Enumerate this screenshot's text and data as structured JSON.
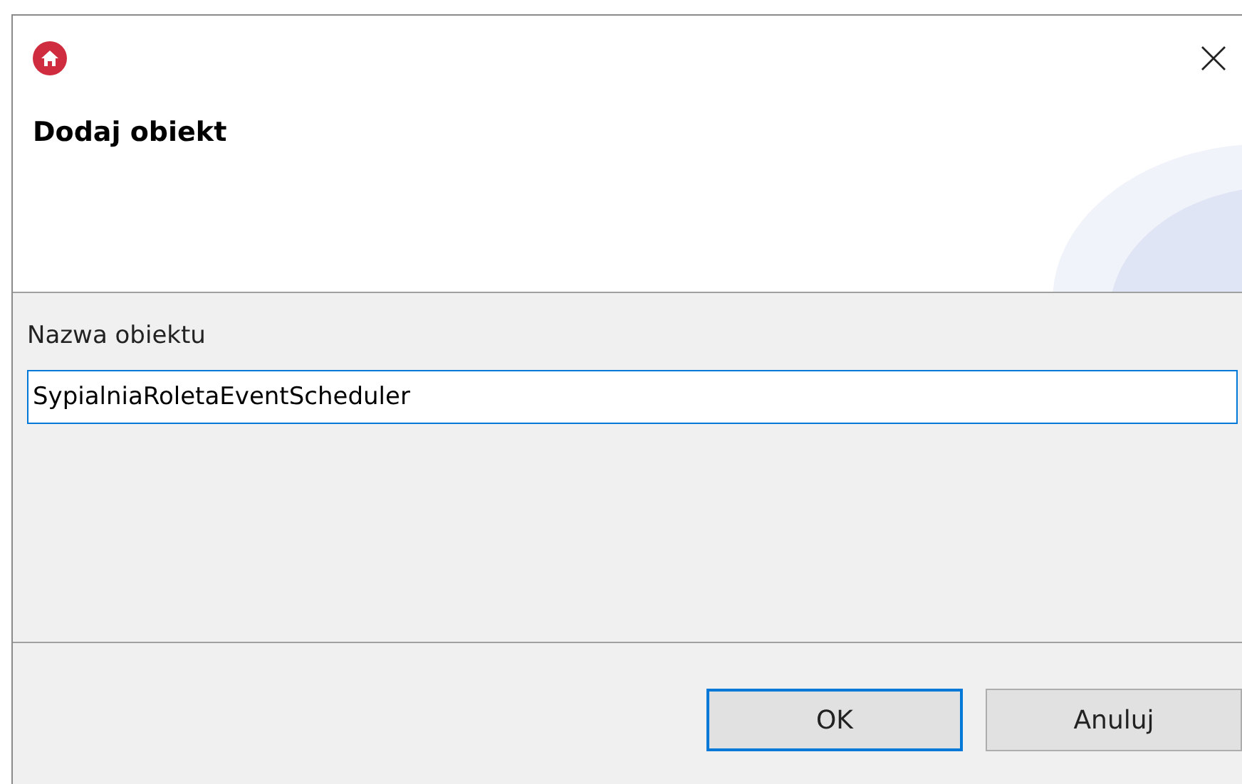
{
  "window": {
    "title": "Dodaj obiekt"
  },
  "form": {
    "label": "Nazwa obiektu",
    "value": "SypialniaRoletaEventScheduler"
  },
  "buttons": [
    {
      "label": "OK",
      "default": true
    },
    {
      "label": "Anuluj",
      "default": false
    }
  ]
}
